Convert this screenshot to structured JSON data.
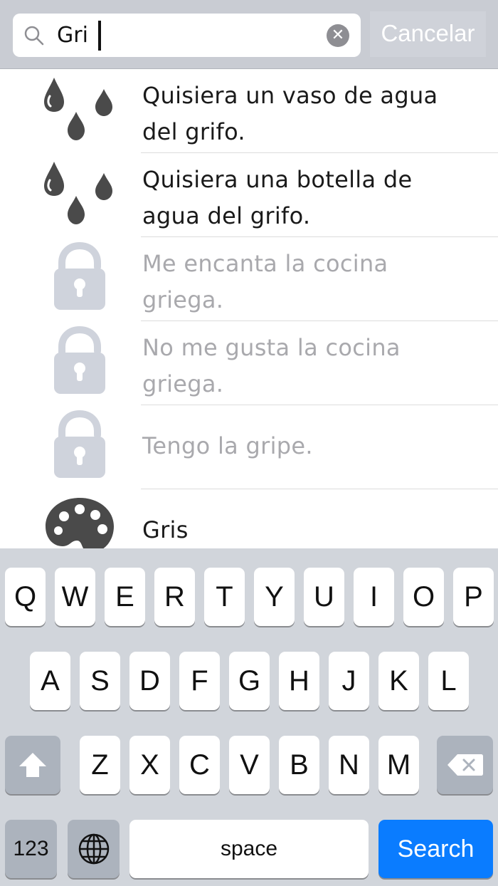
{
  "search": {
    "value": "Gri",
    "clear_glyph": "✕",
    "cancel_label": "Cancelar"
  },
  "results": [
    {
      "text": "Quisiera un vaso de agua del grifo.",
      "icon": "water-drops-icon",
      "locked": false
    },
    {
      "text": "Quisiera una botella de agua del grifo.",
      "icon": "water-drops-icon",
      "locked": false
    },
    {
      "text": "Me encanta la cocina griega.",
      "icon": "lock-icon",
      "locked": true
    },
    {
      "text": "No me gusta la cocina griega.",
      "icon": "lock-icon",
      "locked": true
    },
    {
      "text": "Tengo la gripe.",
      "icon": "lock-icon",
      "locked": true
    },
    {
      "text": "Gris",
      "icon": "palette-icon",
      "locked": false
    }
  ],
  "keyboard": {
    "row1": [
      "Q",
      "W",
      "E",
      "R",
      "T",
      "Y",
      "U",
      "I",
      "O",
      "P"
    ],
    "row2": [
      "A",
      "S",
      "D",
      "F",
      "G",
      "H",
      "J",
      "K",
      "L"
    ],
    "row3": [
      "Z",
      "X",
      "C",
      "V",
      "B",
      "N",
      "M"
    ],
    "numbers_label": "123",
    "space_label": "space",
    "search_label": "Search"
  },
  "colors": {
    "search_key": "#0a7cff",
    "locked_text": "#a9a9ad",
    "icon_dark": "#4a4a4a",
    "icon_locked": "#cfd3dc"
  }
}
